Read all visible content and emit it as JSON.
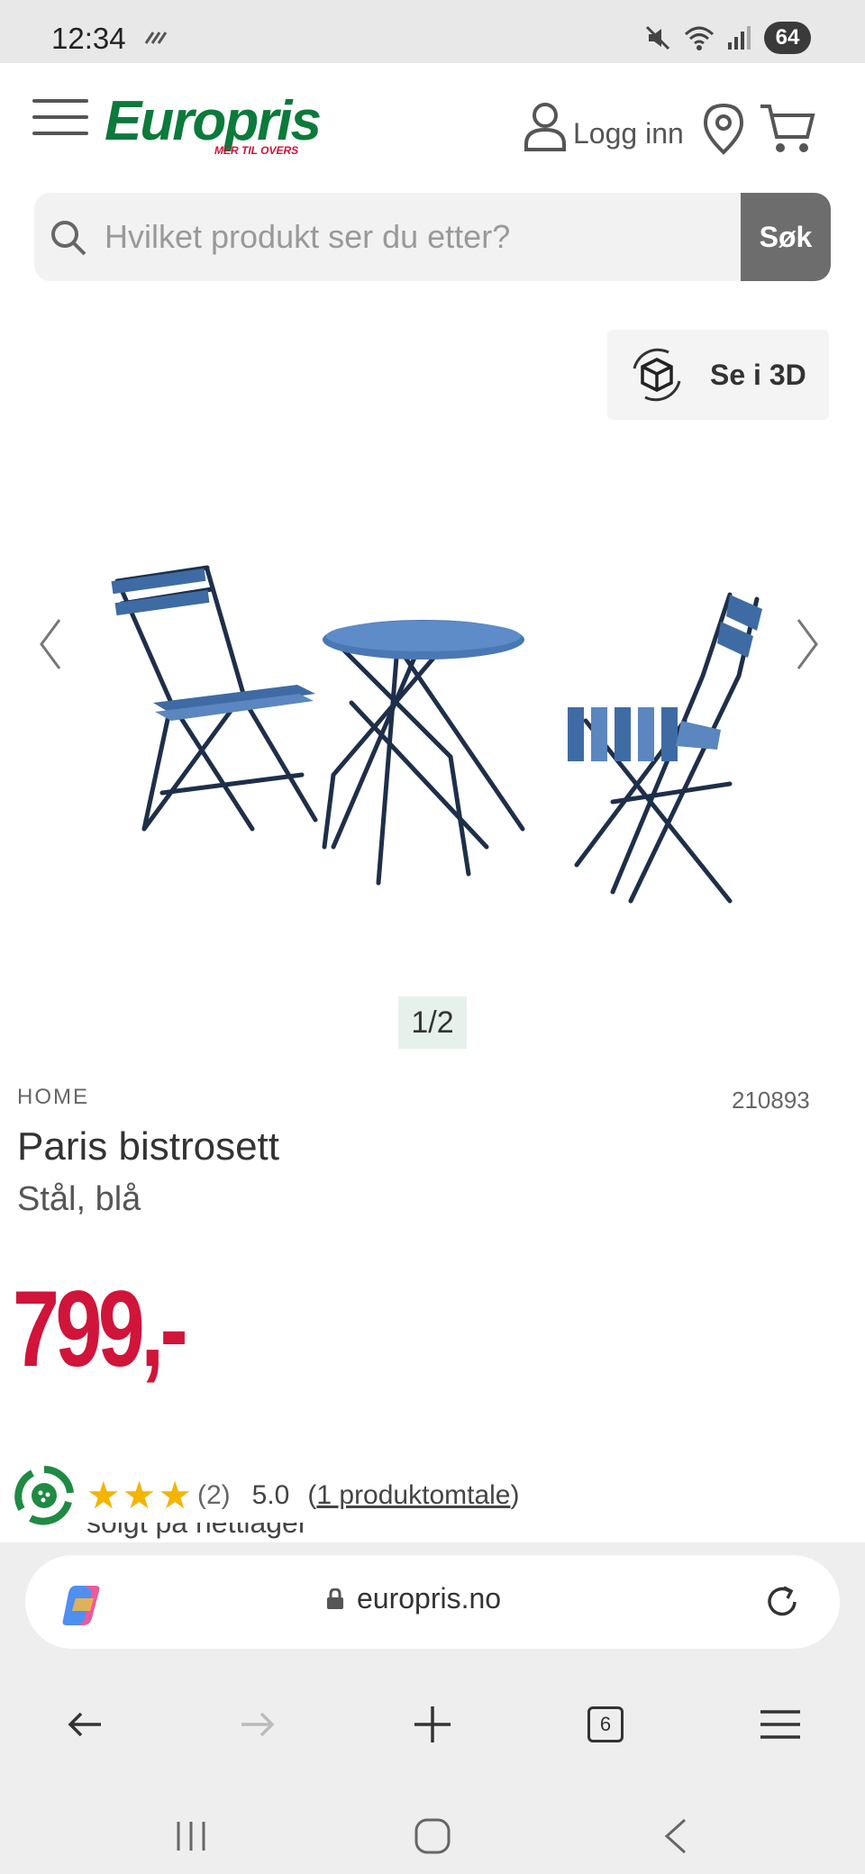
{
  "status_bar": {
    "time": "12:34",
    "battery": "64"
  },
  "header": {
    "logo_text": "Europris",
    "logo_tagline": "MER TIL OVERS",
    "login_label": "Logg inn"
  },
  "search": {
    "placeholder": "Hvilket produkt ser du etter?",
    "button_label": "Søk"
  },
  "view_3d_label": "Se i 3D",
  "gallery": {
    "pager": "1/2"
  },
  "product": {
    "brand": "HOME",
    "sku": "210893",
    "title": "Paris bistrosett",
    "subtitle": "Stål, blå",
    "price": "799,-",
    "rating": {
      "stars": 5,
      "count": "(2)",
      "score": "5.0",
      "reviews_open": "(",
      "reviews_link": "1 produktomtale",
      "reviews_close": ")"
    },
    "stock_text": "solgt på nettlager"
  },
  "browser": {
    "url": "europris.no",
    "tab_count": "6"
  },
  "colors": {
    "brand_green": "#0b7a3b",
    "brand_red": "#d0143a",
    "star": "#f4b400"
  }
}
